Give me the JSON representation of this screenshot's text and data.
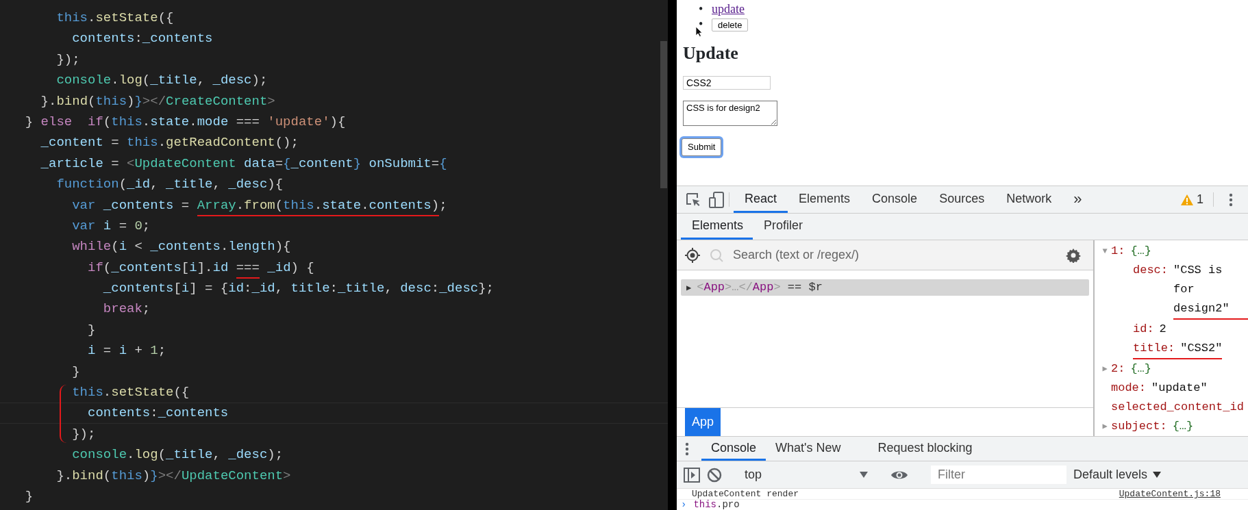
{
  "editor": {
    "lines": [
      {
        "current": false,
        "bracketed": false,
        "spans": [
          {
            "underlined": false,
            "tokens": [
              {
                "text": "      this",
                "kind": "keyword"
              },
              {
                "text": ".",
                "kind": "plain"
              },
              {
                "text": "setState",
                "kind": "function"
              },
              {
                "text": "({",
                "kind": "plain"
              }
            ]
          }
        ]
      },
      {
        "current": false,
        "bracketed": false,
        "spans": [
          {
            "underlined": false,
            "tokens": [
              {
                "text": "        contents",
                "kind": "variable"
              },
              {
                "text": ":",
                "kind": "plain"
              },
              {
                "text": "_contents",
                "kind": "variable"
              }
            ]
          }
        ]
      },
      {
        "current": false,
        "bracketed": false,
        "spans": [
          {
            "underlined": false,
            "tokens": [
              {
                "text": "      });",
                "kind": "plain"
              }
            ]
          }
        ]
      },
      {
        "current": false,
        "bracketed": false,
        "spans": [
          {
            "underlined": false,
            "tokens": [
              {
                "text": "      console",
                "kind": "type"
              },
              {
                "text": ".",
                "kind": "plain"
              },
              {
                "text": "log",
                "kind": "function"
              },
              {
                "text": "(",
                "kind": "plain"
              },
              {
                "text": "_title",
                "kind": "variable"
              },
              {
                "text": ",",
                "kind": "plain"
              },
              {
                "text": " _desc",
                "kind": "variable"
              },
              {
                "text": ");",
                "kind": "plain"
              }
            ]
          }
        ]
      },
      {
        "current": false,
        "bracketed": false,
        "spans": [
          {
            "underlined": false,
            "tokens": [
              {
                "text": "    }.",
                "kind": "plain"
              },
              {
                "text": "bind",
                "kind": "function"
              },
              {
                "text": "(",
                "kind": "plain"
              },
              {
                "text": "this",
                "kind": "keyword"
              },
              {
                "text": ")",
                "kind": "plain"
              },
              {
                "text": "}",
                "kind": "keyword"
              },
              {
                "text": "></",
                "kind": "tag"
              },
              {
                "text": "CreateContent",
                "kind": "type"
              },
              {
                "text": ">",
                "kind": "tag"
              }
            ]
          }
        ]
      },
      {
        "current": false,
        "bracketed": false,
        "spans": [
          {
            "underlined": false,
            "tokens": [
              {
                "text": "  }",
                "kind": "plain"
              },
              {
                "text": " else",
                "kind": "control"
              },
              {
                "text": "  if",
                "kind": "control"
              },
              {
                "text": "(",
                "kind": "plain"
              },
              {
                "text": "this",
                "kind": "keyword"
              },
              {
                "text": ".",
                "kind": "plain"
              },
              {
                "text": "state",
                "kind": "variable"
              },
              {
                "text": ".",
                "kind": "plain"
              },
              {
                "text": "mode",
                "kind": "variable"
              },
              {
                "text": " === ",
                "kind": "plain"
              },
              {
                "text": "'update'",
                "kind": "string"
              },
              {
                "text": "){",
                "kind": "plain"
              }
            ]
          }
        ]
      },
      {
        "current": false,
        "bracketed": false,
        "spans": [
          {
            "underlined": false,
            "tokens": [
              {
                "text": "    _content",
                "kind": "variable"
              },
              {
                "text": " = ",
                "kind": "plain"
              },
              {
                "text": "this",
                "kind": "keyword"
              },
              {
                "text": ".",
                "kind": "plain"
              },
              {
                "text": "getReadContent",
                "kind": "function"
              },
              {
                "text": "();",
                "kind": "plain"
              }
            ]
          }
        ]
      },
      {
        "current": false,
        "bracketed": false,
        "spans": [
          {
            "underlined": false,
            "tokens": [
              {
                "text": "    _article",
                "kind": "variable"
              },
              {
                "text": " = ",
                "kind": "plain"
              },
              {
                "text": "<",
                "kind": "tag"
              },
              {
                "text": "UpdateContent",
                "kind": "type"
              },
              {
                "text": " data",
                "kind": "variable"
              },
              {
                "text": "=",
                "kind": "plain"
              },
              {
                "text": "{",
                "kind": "keyword"
              },
              {
                "text": "_content",
                "kind": "variable"
              },
              {
                "text": "}",
                "kind": "keyword"
              },
              {
                "text": " onSubmit",
                "kind": "variable"
              },
              {
                "text": "=",
                "kind": "plain"
              },
              {
                "text": "{",
                "kind": "keyword"
              }
            ]
          }
        ]
      },
      {
        "current": false,
        "bracketed": false,
        "spans": [
          {
            "underlined": false,
            "tokens": [
              {
                "text": "      function",
                "kind": "keyword"
              },
              {
                "text": "(",
                "kind": "plain"
              },
              {
                "text": "_id",
                "kind": "variable"
              },
              {
                "text": ",",
                "kind": "plain"
              },
              {
                "text": " _title",
                "kind": "variable"
              },
              {
                "text": ",",
                "kind": "plain"
              },
              {
                "text": " _desc",
                "kind": "variable"
              },
              {
                "text": "){",
                "kind": "plain"
              }
            ]
          }
        ]
      },
      {
        "current": false,
        "bracketed": false,
        "spans": [
          {
            "underlined": false,
            "tokens": [
              {
                "text": "        var",
                "kind": "keyword"
              },
              {
                "text": " _contents",
                "kind": "variable"
              },
              {
                "text": " = ",
                "kind": "plain"
              }
            ]
          },
          {
            "underlined": true,
            "tokens": [
              {
                "text": "Array",
                "kind": "type"
              },
              {
                "text": ".",
                "kind": "plain"
              },
              {
                "text": "from",
                "kind": "function"
              },
              {
                "text": "(",
                "kind": "plain"
              },
              {
                "text": "this",
                "kind": "keyword"
              },
              {
                "text": ".",
                "kind": "plain"
              },
              {
                "text": "state",
                "kind": "variable"
              },
              {
                "text": ".",
                "kind": "plain"
              },
              {
                "text": "contents",
                "kind": "variable"
              },
              {
                "text": ")",
                "kind": "plain"
              }
            ]
          },
          {
            "underlined": false,
            "tokens": [
              {
                "text": ";",
                "kind": "plain"
              }
            ]
          }
        ]
      },
      {
        "current": false,
        "bracketed": false,
        "spans": [
          {
            "underlined": false,
            "tokens": [
              {
                "text": "        var",
                "kind": "keyword"
              },
              {
                "text": " i",
                "kind": "variable"
              },
              {
                "text": " = ",
                "kind": "plain"
              },
              {
                "text": "0",
                "kind": "number"
              },
              {
                "text": ";",
                "kind": "plain"
              }
            ]
          }
        ]
      },
      {
        "current": false,
        "bracketed": false,
        "spans": [
          {
            "underlined": false,
            "tokens": [
              {
                "text": "        while",
                "kind": "control"
              },
              {
                "text": "(",
                "kind": "plain"
              },
              {
                "text": "i",
                "kind": "variable"
              },
              {
                "text": " < ",
                "kind": "plain"
              },
              {
                "text": "_contents",
                "kind": "variable"
              },
              {
                "text": ".",
                "kind": "plain"
              },
              {
                "text": "length",
                "kind": "variable"
              },
              {
                "text": "){",
                "kind": "plain"
              }
            ]
          }
        ]
      },
      {
        "current": false,
        "bracketed": false,
        "spans": [
          {
            "underlined": false,
            "tokens": [
              {
                "text": "          if",
                "kind": "control"
              },
              {
                "text": "(",
                "kind": "plain"
              },
              {
                "text": "_contents",
                "kind": "variable"
              },
              {
                "text": "[",
                "kind": "plain"
              },
              {
                "text": "i",
                "kind": "variable"
              },
              {
                "text": "].",
                "kind": "plain"
              },
              {
                "text": "id ",
                "kind": "variable"
              }
            ]
          },
          {
            "underlined": true,
            "tokens": [
              {
                "text": "===",
                "kind": "plain"
              }
            ]
          },
          {
            "underlined": false,
            "tokens": [
              {
                "text": " _id",
                "kind": "variable"
              },
              {
                "text": ") {",
                "kind": "plain"
              }
            ]
          }
        ]
      },
      {
        "current": false,
        "bracketed": false,
        "spans": [
          {
            "underlined": false,
            "tokens": [
              {
                "text": "            _contents",
                "kind": "variable"
              },
              {
                "text": "[",
                "kind": "plain"
              },
              {
                "text": "i",
                "kind": "variable"
              },
              {
                "text": "] = {",
                "kind": "plain"
              },
              {
                "text": "id",
                "kind": "variable"
              },
              {
                "text": ":",
                "kind": "plain"
              },
              {
                "text": "_id",
                "kind": "variable"
              },
              {
                "text": ",",
                "kind": "plain"
              },
              {
                "text": " title",
                "kind": "variable"
              },
              {
                "text": ":",
                "kind": "plain"
              },
              {
                "text": "_title",
                "kind": "variable"
              },
              {
                "text": ",",
                "kind": "plain"
              },
              {
                "text": " desc",
                "kind": "variable"
              },
              {
                "text": ":",
                "kind": "plain"
              },
              {
                "text": "_desc",
                "kind": "variable"
              },
              {
                "text": "};",
                "kind": "plain"
              }
            ]
          }
        ]
      },
      {
        "current": false,
        "bracketed": false,
        "spans": [
          {
            "underlined": false,
            "tokens": [
              {
                "text": "            break",
                "kind": "control"
              },
              {
                "text": ";",
                "kind": "plain"
              }
            ]
          }
        ]
      },
      {
        "current": false,
        "bracketed": false,
        "spans": [
          {
            "underlined": false,
            "tokens": [
              {
                "text": "          }",
                "kind": "plain"
              }
            ]
          }
        ]
      },
      {
        "current": false,
        "bracketed": false,
        "spans": [
          {
            "underlined": false,
            "tokens": [
              {
                "text": "          i",
                "kind": "variable"
              },
              {
                "text": " = ",
                "kind": "plain"
              },
              {
                "text": "i",
                "kind": "variable"
              },
              {
                "text": " + ",
                "kind": "plain"
              },
              {
                "text": "1",
                "kind": "number"
              },
              {
                "text": ";",
                "kind": "plain"
              }
            ]
          }
        ]
      },
      {
        "current": false,
        "bracketed": false,
        "spans": [
          {
            "underlined": false,
            "tokens": [
              {
                "text": "        }",
                "kind": "plain"
              }
            ]
          }
        ]
      },
      {
        "current": false,
        "bracketed": true,
        "spans": [
          {
            "underlined": false,
            "tokens": [
              {
                "text": "        this",
                "kind": "keyword"
              },
              {
                "text": ".",
                "kind": "plain"
              },
              {
                "text": "setState",
                "kind": "function"
              },
              {
                "text": "({",
                "kind": "plain"
              }
            ]
          }
        ]
      },
      {
        "current": true,
        "bracketed": true,
        "spans": [
          {
            "underlined": false,
            "tokens": [
              {
                "text": "          contents",
                "kind": "variable"
              },
              {
                "text": ":",
                "kind": "plain"
              },
              {
                "text": "_contents",
                "kind": "variable"
              }
            ]
          }
        ]
      },
      {
        "current": false,
        "bracketed": true,
        "spans": [
          {
            "underlined": false,
            "tokens": [
              {
                "text": "        });",
                "kind": "plain"
              }
            ]
          }
        ]
      },
      {
        "current": false,
        "bracketed": false,
        "spans": [
          {
            "underlined": false,
            "tokens": [
              {
                "text": "        console",
                "kind": "type"
              },
              {
                "text": ".",
                "kind": "plain"
              },
              {
                "text": "log",
                "kind": "function"
              },
              {
                "text": "(",
                "kind": "plain"
              },
              {
                "text": "_title",
                "kind": "variable"
              },
              {
                "text": ",",
                "kind": "plain"
              },
              {
                "text": " _desc",
                "kind": "variable"
              },
              {
                "text": ");",
                "kind": "plain"
              }
            ]
          }
        ]
      },
      {
        "current": false,
        "bracketed": false,
        "spans": [
          {
            "underlined": false,
            "tokens": [
              {
                "text": "      }.",
                "kind": "plain"
              },
              {
                "text": "bind",
                "kind": "function"
              },
              {
                "text": "(",
                "kind": "plain"
              },
              {
                "text": "this",
                "kind": "keyword"
              },
              {
                "text": ")",
                "kind": "plain"
              },
              {
                "text": "}",
                "kind": "keyword"
              },
              {
                "text": "></",
                "kind": "tag"
              },
              {
                "text": "UpdateContent",
                "kind": "type"
              },
              {
                "text": ">",
                "kind": "tag"
              }
            ]
          }
        ]
      },
      {
        "current": false,
        "bracketed": false,
        "spans": [
          {
            "underlined": false,
            "tokens": [
              {
                "text": "  }",
                "kind": "plain"
              }
            ]
          }
        ]
      }
    ]
  },
  "page": {
    "list_items": [
      {
        "marker": "•",
        "kind": "link",
        "text": "update"
      },
      {
        "marker": "•",
        "kind": "button",
        "text": "delete"
      }
    ],
    "heading": "Update",
    "title_input": {
      "value": "CSS2"
    },
    "desc_textarea": {
      "value": "CSS is for design2"
    },
    "submit_button": {
      "label": "Submit",
      "focused": true
    }
  },
  "devtools": {
    "tabs": [
      {
        "label": "React",
        "selected": true
      },
      {
        "label": "Elements",
        "selected": false
      },
      {
        "label": "Console",
        "selected": false
      },
      {
        "label": "Sources",
        "selected": false
      },
      {
        "label": "Network",
        "selected": false
      }
    ],
    "more_tabs": "»",
    "warnings": "1",
    "subtabs": [
      {
        "label": "Elements",
        "selected": true
      },
      {
        "label": "Profiler",
        "selected": false
      }
    ],
    "search": {
      "placeholder": "Search (text or /regex/)"
    },
    "tree": [
      {
        "expander": "▶",
        "selected": true,
        "tokens": [
          {
            "text": "<",
            "kind": "punct"
          },
          {
            "text": "App",
            "kind": "name"
          },
          {
            "text": ">…</",
            "kind": "punct"
          },
          {
            "text": "App",
            "kind": "name"
          },
          {
            "text": ">",
            "kind": "punct"
          },
          {
            "text": " == $r",
            "kind": "plain"
          }
        ]
      }
    ],
    "breadcrumbs": [
      {
        "label": "App",
        "selected": true
      }
    ],
    "props": [
      {
        "expander": "▼",
        "key": "1:",
        "value": "{…}",
        "kind": "object",
        "underlined": false,
        "children": [
          {
            "key": "desc:",
            "value": "\"CSS is for design2\"",
            "kind": "string",
            "underlined": true
          },
          {
            "key": "id:",
            "value": "2",
            "kind": "number",
            "underlined": false
          },
          {
            "key": "title:",
            "value": "\"CSS2\"",
            "kind": "string",
            "underlined": true
          }
        ]
      },
      {
        "expander": "▶",
        "key": "2:",
        "value": "{…}",
        "kind": "object",
        "underlined": false
      },
      {
        "key": "mode:",
        "value": "\"update\"",
        "kind": "string",
        "underlined": false
      },
      {
        "key": "selected_content_id",
        "underlined": false
      },
      {
        "expander": "▶",
        "key": "subject:",
        "value": "{…}",
        "kind": "object",
        "underlined": false
      }
    ],
    "drawer_tabs": [
      {
        "label": "Console",
        "selected": true
      },
      {
        "label": "What's New",
        "selected": false
      },
      {
        "label": "Request blocking",
        "selected": false
      }
    ],
    "context": "top",
    "filter": {
      "placeholder": "Filter"
    },
    "levels": "Default levels",
    "messages": [
      {
        "text": "UpdateContent render",
        "source": "UpdateContent.js:18"
      }
    ],
    "prompt": {
      "symbol": "›",
      "tokens": [
        {
          "text": "this",
          "kind": "keyword"
        },
        {
          "text": ".pro",
          "kind": "plain"
        }
      ]
    }
  }
}
